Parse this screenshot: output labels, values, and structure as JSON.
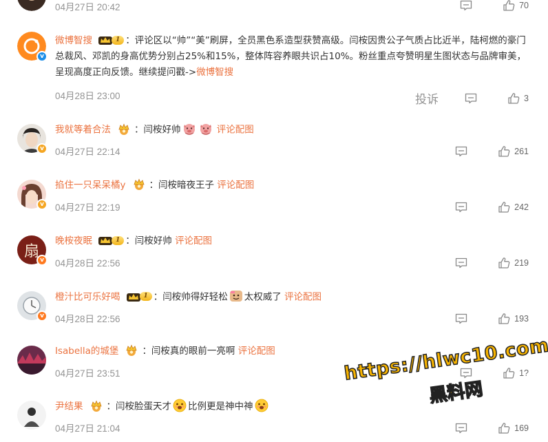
{
  "comments": [
    {
      "time": "04月27日 20:42",
      "likes": "70"
    },
    {
      "username": "微博智搜",
      "level": "1",
      "text": "：评论区以“帅”“美”刷屏，全员黑色系造型获赞高级。闫桉因贵公子气质占比近半，陆柯燃的豪门总裁风、邓凯的身高优势分别占25%和15%，整体阵容养眼共识占10%。粉丝重点夸赞明星生图状态与品牌审美，呈现高度正向反馈。继续提问戳->",
      "link": "微博智搜",
      "time": "04月28日 23:00",
      "report": "投诉",
      "likes": "3"
    },
    {
      "username": "我就等着合法",
      "text": "：闫桉好帅",
      "link": "评论配图",
      "time": "04月27日 22:14",
      "likes": "261"
    },
    {
      "username": "掐住一只呆呆橘y",
      "text": "：闫桉暗夜王子",
      "link": "评论配图",
      "time": "04月27日 22:19",
      "likes": "242"
    },
    {
      "username": "晚桉夜眠",
      "level": "1",
      "text": "：闫桉好帅",
      "link": "评论配图",
      "time": "04月28日 22:56",
      "likes": "219"
    },
    {
      "username": "橙汁比可乐好喝",
      "level": "1",
      "text": "：闫桉帅得好轻松",
      "text2": "太权威了",
      "link": "评论配图",
      "time": "04月28日 22:56",
      "likes": "193"
    },
    {
      "username": "Isabella的城堡",
      "text": "：闫桉真的眼前一亮啊",
      "link": "评论配图",
      "time": "04月27日 23:51",
      "likes": "1?"
    },
    {
      "username": "尹结果",
      "text": "：闫桉脸蛋天才",
      "text2": "比例更是神中神",
      "time": "04月27日 21:04",
      "likes": "169"
    }
  ],
  "avatar_glyph": "扇",
  "watermark": {
    "line1": "https://hlwc10.com",
    "line2": "黑料网"
  },
  "colors": {
    "username": "#eb7340",
    "timestamp": "#939393",
    "verified_blue": "#1c8ee8",
    "verified_gold": "#f5a623",
    "verified_orange": "#ff7a20",
    "watermark": "#f6b300"
  }
}
